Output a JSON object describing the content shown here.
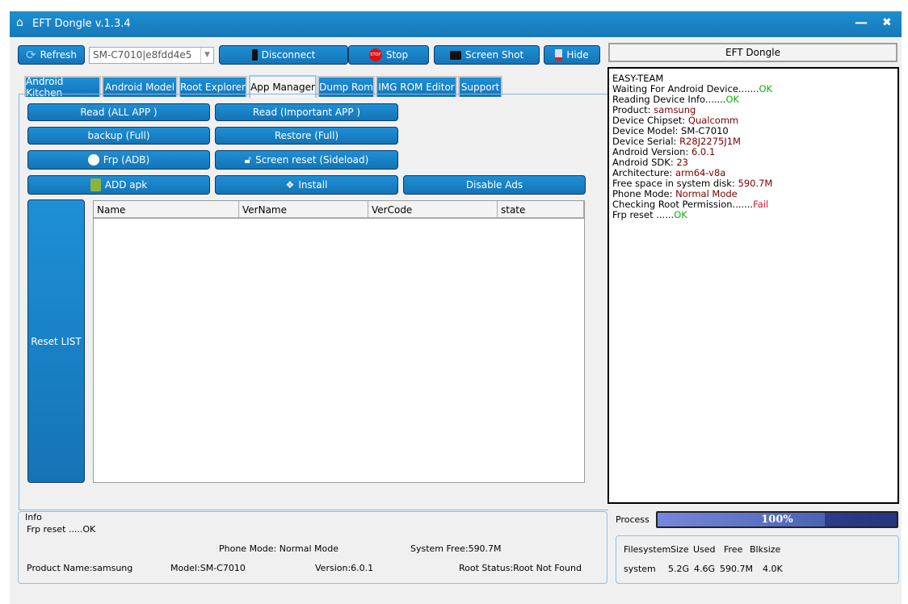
{
  "window": {
    "title": "EFT Dongle  v.1.3.4",
    "minimize": "—",
    "close": "✖"
  },
  "toolbar": {
    "refresh": "Refresh",
    "device": "SM-C7010|e8fdd4e5",
    "disconnect": "Disconnect",
    "stop": "Stop",
    "stop_badge": "STOP",
    "screenshot": "Screen Shot",
    "hide": "Hide"
  },
  "tabs": [
    "Android Kitchen",
    "Android Model",
    "Root Explorer",
    "App Manager",
    "Dump Rom",
    "IMG ROM Editor",
    "Support"
  ],
  "active_tab": "App Manager",
  "actions": {
    "read_all": "Read (ALL APP )",
    "read_important": "Read (Important APP )",
    "backup": "backup (Full)",
    "restore": "Restore (Full)",
    "frp": "Frp (ADB)",
    "screen_reset": "Screen reset  (Sideload)",
    "add_apk": "ADD apk",
    "install": "Install",
    "disable_ads": "Disable Ads",
    "reset_list": "Reset LIST"
  },
  "table": {
    "columns": [
      "Name",
      "VerName",
      "VerCode",
      "state"
    ],
    "rows": []
  },
  "log_panel": {
    "title": "EFT Dongle",
    "lines": [
      {
        "label": "EASY-TEAM",
        "value": "",
        "kind": "plain"
      },
      {
        "label": "Waiting For Android Device.......",
        "value": "OK",
        "kind": "ok"
      },
      {
        "label": "Reading Device Info.......",
        "value": "OK",
        "kind": "ok"
      },
      {
        "label": "Product: ",
        "value": "samsung",
        "kind": "val"
      },
      {
        "label": "Device Chipset: ",
        "value": "Qualcomm",
        "kind": "val"
      },
      {
        "label": "Device Model: ",
        "value": "SM-C7010",
        "kind": "plain"
      },
      {
        "label": "Device Serial: ",
        "value": "R28J2275J1M",
        "kind": "val"
      },
      {
        "label": "Android Version: ",
        "value": "6.0.1",
        "kind": "val"
      },
      {
        "label": "Android SDK: ",
        "value": "23",
        "kind": "val"
      },
      {
        "label": "Architecture: ",
        "value": "arm64-v8a",
        "kind": "val"
      },
      {
        "label": "Free space in system disk: ",
        "value": "590.7M",
        "kind": "val"
      },
      {
        "label": "Phone Mode: ",
        "value": "Normal Mode",
        "kind": "val"
      },
      {
        "label": "Checking Root Permission.......",
        "value": "Fail",
        "kind": "fail"
      },
      {
        "label": "Frp reset ......",
        "value": "OK",
        "kind": "ok"
      }
    ]
  },
  "info": {
    "title": "Info",
    "status": "Frp reset .....OK",
    "phone_mode": "Phone Mode: Normal Mode",
    "system_free": "System Free:590.7M",
    "product": "Product Name:samsung",
    "model": "Model:SM-C7010",
    "version": "Version:6.0.1",
    "root_status": "Root Status:Root Not Found"
  },
  "process": {
    "label": "Process",
    "percent": 100,
    "percent_text": "100%"
  },
  "filesystem": {
    "headers": [
      "Filesystem",
      "Size",
      "Used",
      "Free",
      "Blksize"
    ],
    "row": [
      "system",
      "5.2G",
      "4.6G",
      "590.7M",
      "4.0K"
    ]
  },
  "colors": {
    "accent": "#1a84c8",
    "ok": "#10b010",
    "fail": "#e8102a",
    "value": "#7a0000"
  }
}
